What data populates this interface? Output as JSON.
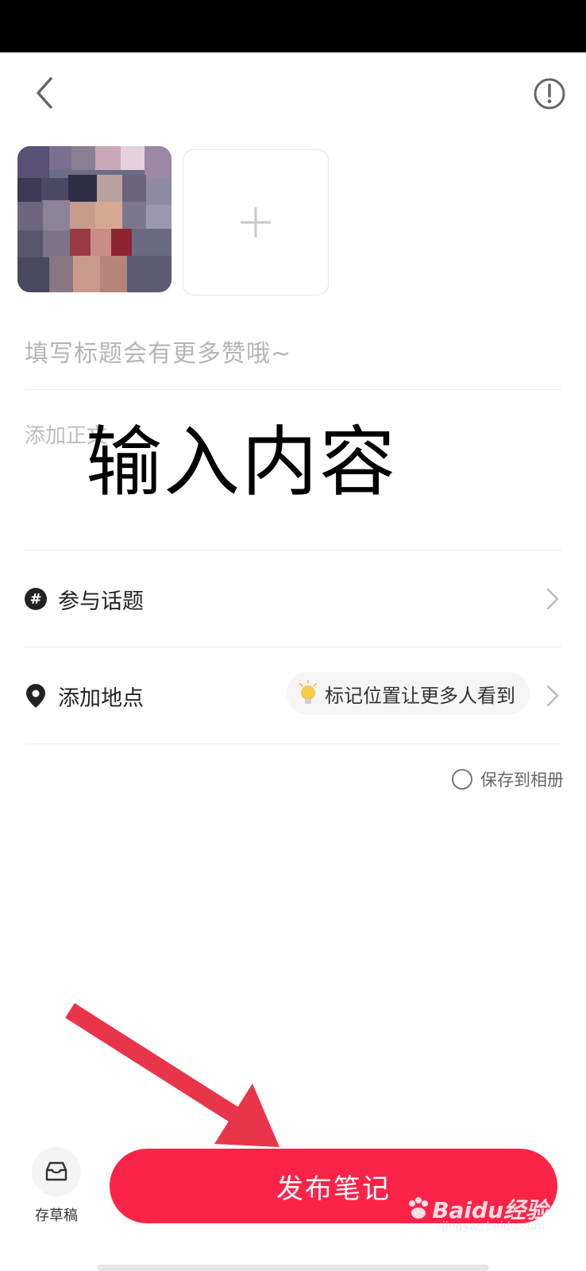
{
  "note_editor": {
    "title_placeholder": "填写标题会有更多赞哦~",
    "body_placeholder": "添加正文",
    "overlay_annotation": "输入内容",
    "topic_label": "参与话题",
    "location_label": "添加地点",
    "location_hint": "标记位置让更多人看到",
    "save_to_album": "保存到相册",
    "draft_label": "存草稿",
    "publish_label": "发布笔记"
  },
  "icons": {
    "back": "chevron-left-icon",
    "info": "exclamation-circle-icon",
    "add_photo": "plus-icon",
    "topic": "hashtag-icon",
    "location": "map-pin-icon",
    "location_hint": "lightbulb-icon",
    "chevron": "chevron-right-icon",
    "draft": "inbox-icon"
  },
  "watermark": {
    "brand": "Baidu经验",
    "url": "jingyan.baidu.com"
  },
  "colors": {
    "accent": "#fb2448",
    "annotation_arrow": "#e8354a"
  }
}
